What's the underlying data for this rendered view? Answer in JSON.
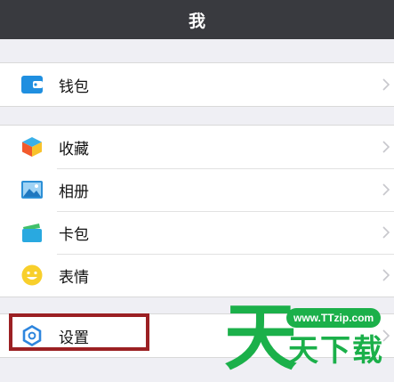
{
  "header": {
    "title": "我"
  },
  "groups": [
    {
      "items": [
        {
          "label": "钱包",
          "icon": "wallet-icon"
        }
      ]
    },
    {
      "items": [
        {
          "label": "收藏",
          "icon": "favorites-cube-icon"
        },
        {
          "label": "相册",
          "icon": "album-picture-icon"
        },
        {
          "label": "卡包",
          "icon": "card-wallet-icon"
        },
        {
          "label": "表情",
          "icon": "smiley-icon"
        }
      ]
    },
    {
      "items": [
        {
          "label": "设置",
          "icon": "settings-gear-icon"
        }
      ]
    }
  ],
  "watermark": {
    "url": "www.TTzip.com",
    "big_char": "天",
    "text": "天下载"
  },
  "colors": {
    "header_bg": "#393a3f",
    "highlight_border": "#9b2023",
    "watermark_green": "#1bb04a"
  }
}
